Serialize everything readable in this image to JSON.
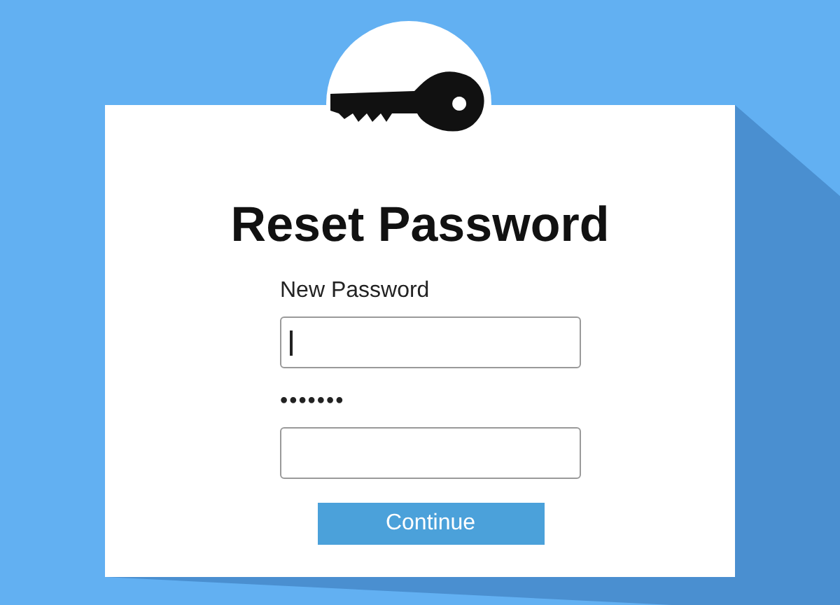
{
  "title": "Reset Password",
  "fields": [
    {
      "label": "New Password",
      "caret": true
    },
    {
      "label": "•••••••",
      "caret": false
    }
  ],
  "button": {
    "label": "Continue"
  }
}
